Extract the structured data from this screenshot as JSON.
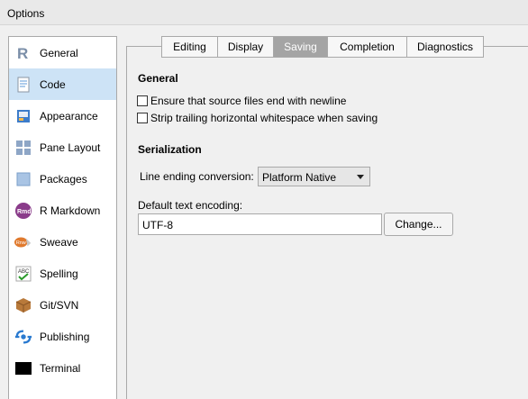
{
  "window": {
    "title": "Options"
  },
  "sidebar": {
    "items": [
      {
        "label": "General",
        "icon": "r-logo-icon"
      },
      {
        "label": "Code",
        "icon": "code-document-icon"
      },
      {
        "label": "Appearance",
        "icon": "appearance-icon"
      },
      {
        "label": "Pane Layout",
        "icon": "pane-layout-icon"
      },
      {
        "label": "Packages",
        "icon": "packages-icon"
      },
      {
        "label": "R Markdown",
        "icon": "rmd-icon"
      },
      {
        "label": "Sweave",
        "icon": "sweave-icon"
      },
      {
        "label": "Spelling",
        "icon": "spelling-icon"
      },
      {
        "label": "Git/SVN",
        "icon": "git-svn-icon"
      },
      {
        "label": "Publishing",
        "icon": "publishing-icon"
      },
      {
        "label": "Terminal",
        "icon": "terminal-icon"
      }
    ],
    "selected_index": 1
  },
  "tabs": [
    "Editing",
    "Display",
    "Saving",
    "Completion",
    "Diagnostics"
  ],
  "active_tab": "Saving",
  "general": {
    "heading": "General",
    "ensure_newline": "Ensure that source files end with newline",
    "strip_whitespace": "Strip trailing horizontal whitespace when saving"
  },
  "serialization": {
    "heading": "Serialization",
    "line_ending_label": "Line ending conversion:",
    "line_ending_value": "Platform Native",
    "encoding_label": "Default text encoding:",
    "encoding_value": "UTF-8",
    "change_button": "Change..."
  },
  "colors": {
    "selected_bg": "#cde3f6",
    "active_tab_bg": "#a4a4a4"
  }
}
